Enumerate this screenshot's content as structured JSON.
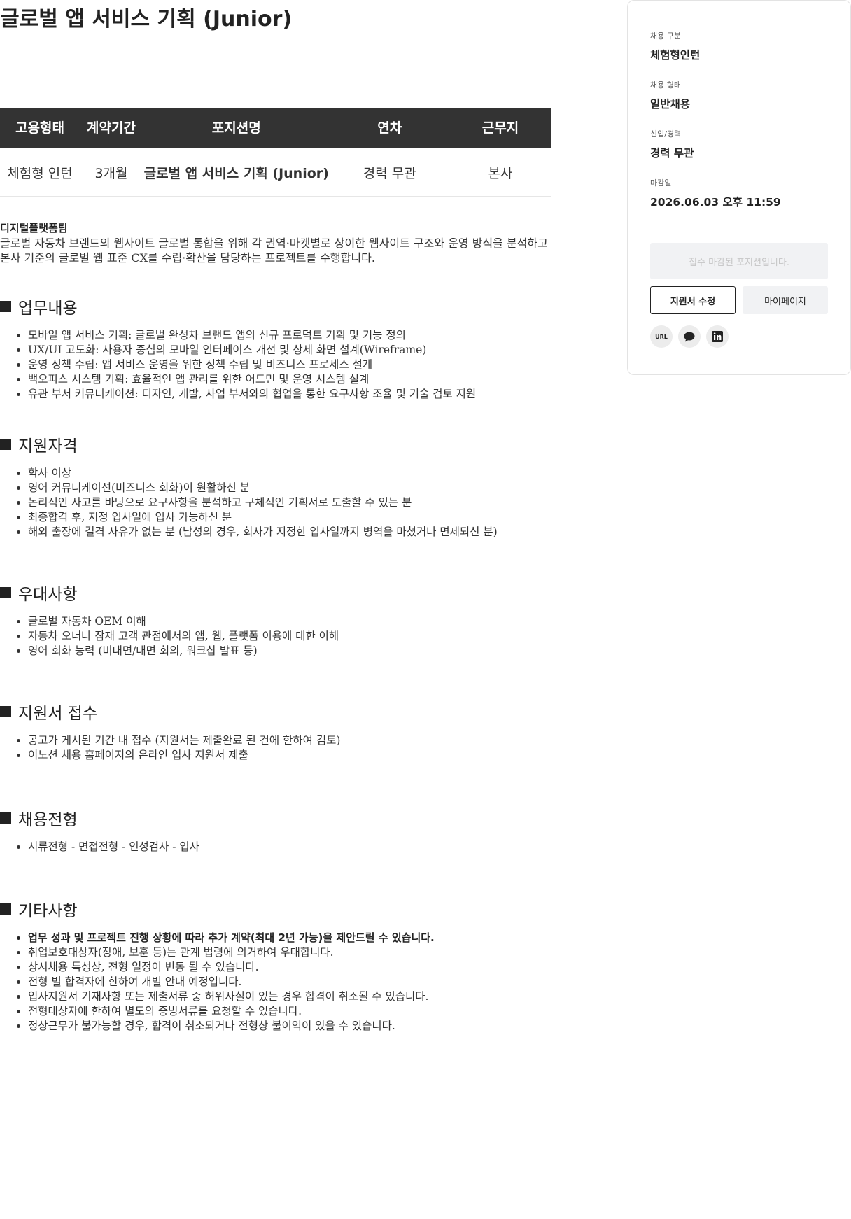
{
  "page": {
    "title": "글로벌 앱 서비스 기획 (Junior)"
  },
  "info_table": {
    "headers": [
      "고용형태",
      "계약기간",
      "포지션명",
      "연차",
      "근무지"
    ],
    "row": [
      "체험형 인턴",
      "3개월",
      "글로벌 앱 서비스 기획 (Junior)",
      "경력 무관",
      "본사"
    ]
  },
  "intro": {
    "team": "디지털플랫폼팀",
    "line1": "글로벌 자동차 브랜드의 웹사이트 글로벌 통합을 위해 각 권역·마켓별로 상이한 웹사이트 구조와 운영 방식을 분석하고",
    "line2": "본사 기준의 글로벌 웹 표준 CX를 수립·확산을 담당하는 프로젝트를 수행합니다."
  },
  "sections": {
    "duties": {
      "title": "업무내용",
      "items": [
        "모바일 앱 서비스 기획: 글로벌 완성차 브랜드 앱의 신규 프로덕트 기획 및 기능 정의",
        "UX/UI 고도화: 사용자 중심의 모바일 인터페이스 개선 및 상세 화면 설계(Wireframe)",
        "운영 정책 수립: 앱 서비스 운영을 위한 정책 수립 및 비즈니스 프로세스 설계",
        "백오피스 시스템 기획: 효율적인 앱 관리를 위한 어드민 및 운영 시스템 설계",
        "유관 부서 커뮤니케이션: 디자인, 개발, 사업 부서와의 협업을 통한 요구사항 조율 및 기술 검토 지원"
      ]
    },
    "qualifications": {
      "title": "지원자격",
      "items": [
        "학사 이상",
        "영어 커뮤니케이션(비즈니스 회화)이 원활하신 분",
        "논리적인 사고를 바탕으로 요구사항을 분석하고 구체적인 기획서로 도출할 수 있는 분",
        "최종합격 후, 지정 입사일에 입사 가능하신 분",
        "해외 출장에 결격 사유가 없는 분 (남성의 경우, 회사가 지정한 입사일까지 병역을 마쳤거나 면제되신 분)"
      ]
    },
    "preferences": {
      "title": "우대사항",
      "items": [
        "글로벌 자동차 OEM 이해",
        "자동차 오너나 잠재 고객 관점에서의 앱, 웹, 플랫폼 이용에 대한 이해",
        "영어 회화 능력 (비대면/대면 회의, 워크샵 발표 등)"
      ]
    },
    "application": {
      "title": "지원서 접수",
      "items": [
        "공고가 게시된 기간 내 접수 (지원서는 제출완료 된 건에 한하여 검토)",
        "이노션 채용 홈페이지의 온라인 입사 지원서 제출"
      ]
    },
    "process": {
      "title": "채용전형",
      "items": [
        "서류전형 - 면접전형 - 인성검사 - 입사"
      ]
    },
    "etc": {
      "title": "기타사항",
      "strong_item": "업무 성과 및 프로젝트 진행 상황에 따라 추가 계약(최대 2년 가능)을 제안드릴 수 있습니다.",
      "items": [
        "취업보호대상자(장애, 보훈 등)는 관계 법령에 의거하여 우대합니다.",
        "상시채용 특성상, 전형 일정이 변동 될 수 있습니다.",
        "전형 별 합격자에 한하여 개별 안내 예정입니다.",
        "입사지원서 기재사항 또는 제출서류 중 허위사실이 있는 경우 합격이 취소될 수 있습니다.",
        "전형대상자에 한하여 별도의 증빙서류를 요청할 수 있습니다.",
        "정상근무가 불가능할 경우, 합격이 취소되거나 전형상 불이익이 있을 수 있습니다."
      ]
    }
  },
  "sidebar": {
    "recruit_type_label": "채용 구분",
    "recruit_type_value": "체험형인턴",
    "employment_label": "채용 형태",
    "employment_value": "일반채용",
    "career_label": "신입/경력",
    "career_value": "경력 무관",
    "deadline_label": "마감일",
    "deadline_value": "2026.06.03 오후 11:59",
    "closed_label": "접수 마감된 포지션입니다.",
    "edit_label": "지원서 수정",
    "mypage_label": "마이페이지",
    "share_url_label": "URL",
    "share_icons": [
      "url-icon",
      "chat-bubble-icon",
      "linkedin-icon"
    ]
  }
}
